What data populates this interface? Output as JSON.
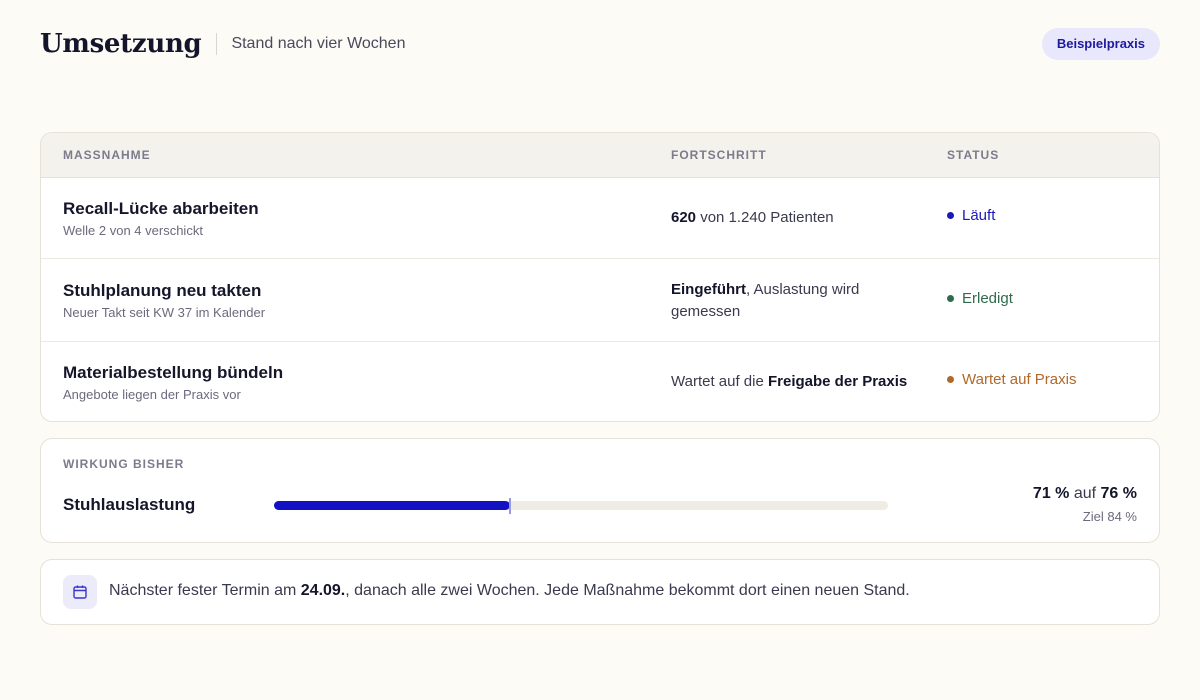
{
  "header": {
    "title": "Umsetzung",
    "subtitle": "Stand nach vier Wochen",
    "badge": "Beispielpraxis"
  },
  "table": {
    "columns": [
      "MASSNAHME",
      "FORTSCHRITT",
      "STATUS"
    ],
    "rows": [
      {
        "title": "Recall-Lücke abarbeiten",
        "subtitle": "Welle 2 von 4 verschickt",
        "progress_bold": "620",
        "progress_rest": " von 1.240 Patienten",
        "status": "Läuft",
        "status_color": "#1a18b8"
      },
      {
        "title": "Stuhlplanung neu takten",
        "subtitle": "Neuer Takt seit KW 37 im Kalender",
        "progress_bold": "Eingeführt",
        "progress_rest": ", Auslastung wird gemessen",
        "status": "Erledigt",
        "status_color": "#2f6a4c"
      },
      {
        "title": "Materialbestellung bündeln",
        "subtitle": "Angebote liegen der Praxis vor",
        "progress_pre": "Wartet auf die ",
        "progress_bold": "Freigabe der Praxis",
        "status": "Wartet auf Praxis",
        "status_color": "#b0692a"
      }
    ]
  },
  "impact": {
    "heading": "WIRKUNG BISHER",
    "label": "Stuhlauslastung",
    "from_value": "71 %",
    "connector": " auf ",
    "to_value": "76 %",
    "goal": "Ziel 84 %",
    "progress_fraction": 0.385,
    "marker_fraction": 0.385,
    "bar_color": "#1212c4"
  },
  "footer": {
    "icon": "calendar-icon",
    "text_pre": "Nächster fester Termin am ",
    "date": "24.09.",
    "text_post": ", danach alle zwei Wochen. Jede Maßnahme bekommt dort einen neuen Stand."
  }
}
